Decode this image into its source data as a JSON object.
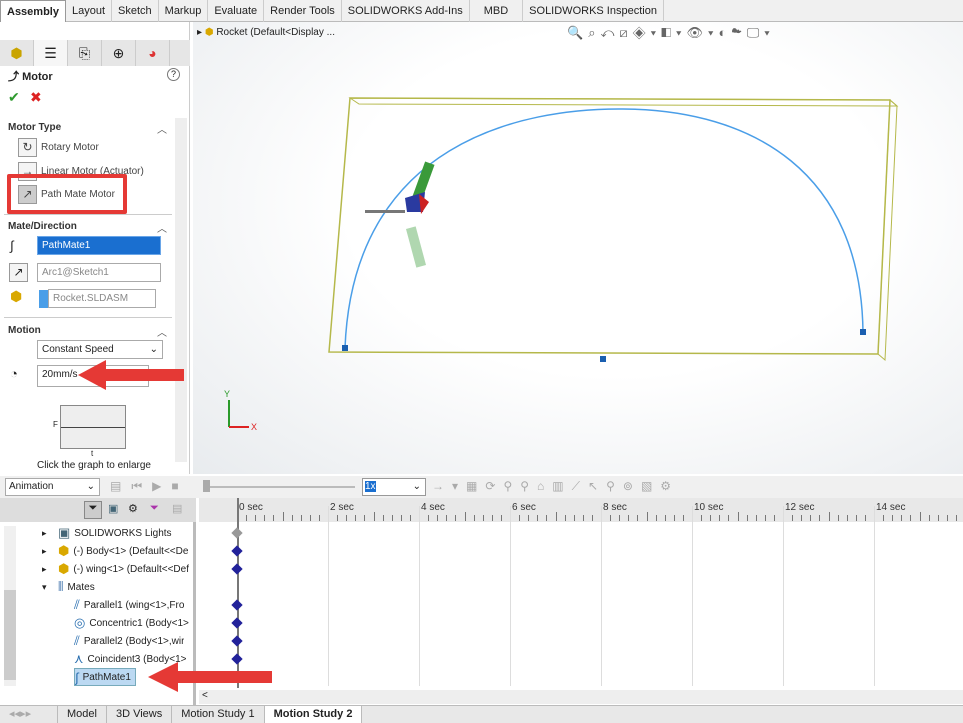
{
  "ribbon_tabs": [
    "Assembly",
    "Layout",
    "Sketch",
    "Markup",
    "Evaluate",
    "Render Tools",
    "SOLIDWORKS Add-Ins",
    "MBD",
    "SOLIDWORKS Inspection"
  ],
  "active_ribbon_tab": "Assembly",
  "property_manager": {
    "title": "Motor",
    "help": "?",
    "ok": "✔",
    "cancel": "✖",
    "motor_type": {
      "heading": "Motor Type",
      "options": [
        "Rotary Motor",
        "Linear Motor (Actuator)",
        "Path Mate Motor"
      ],
      "selected": "Path Mate Motor"
    },
    "mate_direction": {
      "heading": "Mate/Direction",
      "mate": "PathMate1",
      "direction": "Arc1@Sketch1",
      "component": "Rocket.SLDASM"
    },
    "motion": {
      "heading": "Motion",
      "type": "Constant Speed",
      "speed": "20mm/s",
      "graph_y": "F",
      "graph_x": "t",
      "graph_caption": "Click the graph to enlarge"
    }
  },
  "viewport": {
    "tree_root": "Rocket  (Default<Display ...",
    "accent": "#4a9ee8",
    "box_color": "#b5b84a"
  },
  "motion_manager": {
    "study_type": "Animation",
    "playback_speed": "1x",
    "time_labels": [
      "0 sec",
      "2 sec",
      "4 sec",
      "6 sec",
      "8 sec",
      "10 sec",
      "12 sec",
      "14 sec"
    ],
    "tree": [
      {
        "label": "SOLIDWORKS Lights",
        "icon": "lights-icon",
        "indent": 0,
        "expand": "▸"
      },
      {
        "label": "(-) Body<1> (Default<<De",
        "icon": "part-icon",
        "indent": 0,
        "expand": "▸"
      },
      {
        "label": "(-) wing<1> (Default<<Def",
        "icon": "part-icon",
        "indent": 0,
        "expand": "▸"
      },
      {
        "label": "Mates",
        "icon": "mates-icon",
        "indent": 0,
        "expand": "▾"
      },
      {
        "label": "Parallel1 (wing<1>,Fro",
        "icon": "parallel-icon",
        "indent": 1
      },
      {
        "label": "Concentric1 (Body<1>",
        "icon": "concentric-icon",
        "indent": 1
      },
      {
        "label": "Parallel2 (Body<1>,wir",
        "icon": "parallel-icon",
        "indent": 1
      },
      {
        "label": "Coincident3 (Body<1>",
        "icon": "coincident-icon",
        "indent": 1
      },
      {
        "label": "PathMate1",
        "icon": "path-mate-icon",
        "indent": 1,
        "selected": true
      }
    ]
  },
  "bottom_tabs": [
    "Model",
    "3D Views",
    "Motion Study 1",
    "Motion Study 2"
  ],
  "active_bottom_tab": "Motion Study 2"
}
